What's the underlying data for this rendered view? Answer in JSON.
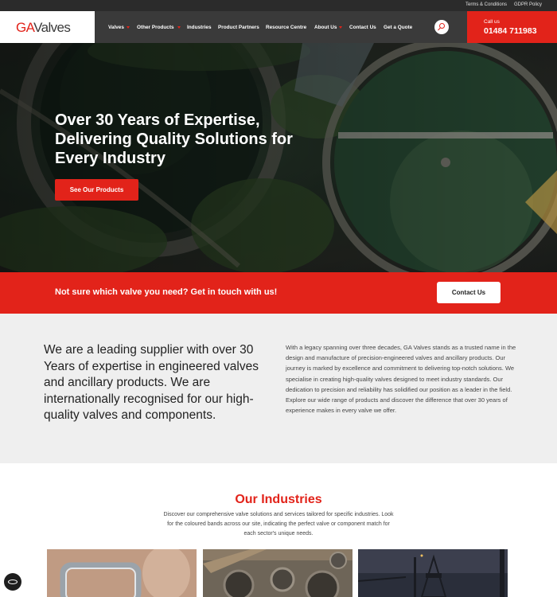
{
  "topbar": {
    "links": [
      "Terms & Conditions",
      "GDPR Policy"
    ]
  },
  "header": {
    "logo": {
      "ga": "GA",
      "valves": "Valves"
    },
    "nav": [
      "Valves",
      "Other Products",
      "Industries",
      "Product Partners",
      "Resource Centre",
      "About Us",
      "Contact Us",
      "Get a Quote"
    ],
    "search_icon": "search-icon",
    "call_label": "Call us",
    "call_number": "01484 711983"
  },
  "hero": {
    "title": "Over 30 Years of Expertise, Delivering Quality Solutions for Every Industry",
    "button_label": "See Our Products"
  },
  "banner": {
    "text": "Not sure which valve you need? Get in touch with us!",
    "button_label": "Contact Us"
  },
  "about": {
    "lead": "We are a leading supplier with over 30 Years of expertise in engineered valves and ancillary products. We are internationally recognised for our high-quality valves and components.",
    "paragraphs": [
      "With a legacy spanning over three decades, GA Valves stands as a trusted name in the design and manufacture of precision-engineered valves and ancillary products. Our journey is marked by excellence and commitment to delivering top-notch solutions. We specialise in creating high-quality valves designed to meet industry standards. Our dedication to precision and reliability has solidified our position as a leader in the field.",
      "Explore our wide range of products and discover the difference that over 30 years of experience makes in every valve we offer."
    ]
  },
  "industries": {
    "title": "Our Industries",
    "description": "Discover our comprehensive valve solutions and services tailored for specific industries. Look for the coloured bands across our site, indicating the perfect valve or component match for each sector's unique needs."
  },
  "colors": {
    "brand_red": "#e2231a",
    "header_grey": "#3a3a3a",
    "topbar": "#2b2b2b",
    "about_bg": "#efefef"
  }
}
